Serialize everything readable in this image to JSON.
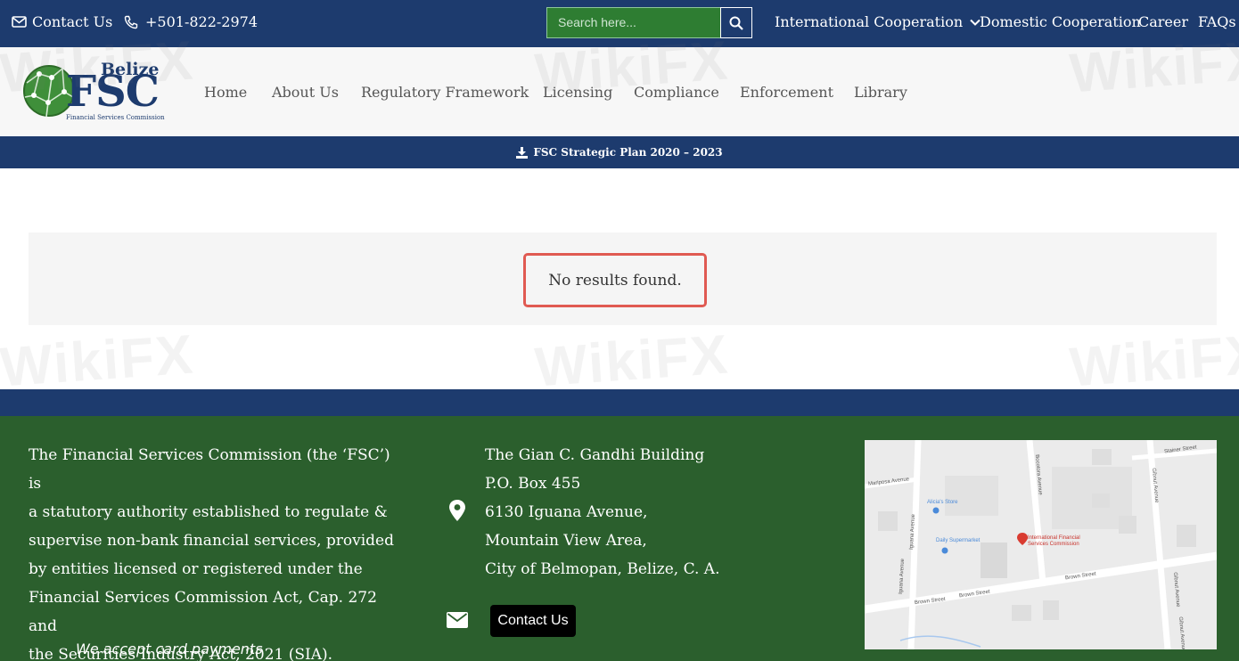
{
  "topbar": {
    "contact_label": "Contact Us",
    "phone": "+501-822-2974",
    "search_placeholder": "Search here...",
    "nav": [
      "International Cooperation",
      "Domestic Cooperation",
      "Career",
      "FAQs"
    ]
  },
  "logo": {
    "word_top": "Belize",
    "word_main": "FSC",
    "tagline": "Financial Services Commission"
  },
  "mainnav": [
    "Home",
    "About Us",
    "Regulatory Framework",
    "Licensing",
    "Compliance",
    "Enforcement",
    "Library"
  ],
  "banner": {
    "label": "FSC Strategic Plan 2020 – 2023"
  },
  "results": {
    "message": "No results found."
  },
  "footer": {
    "about_lines": [
      "The Financial Services Commission (the ‘FSC’) is",
      "a statutory authority established to regulate &",
      "supervise non-bank financial services, provided",
      "by entities licensed or registered under the",
      "Financial Services Commission Act, Cap. 272 and",
      "the Securities Industry Act, 2021 (SIA)."
    ],
    "cards_text": "We accept card payments",
    "address_lines": [
      "The Gian C. Gandhi Building",
      "P.O. Box 455",
      "6130 Iguana Avenue,",
      "Mountain View Area,",
      "City of Belmopan, Belize, C. A."
    ],
    "contact_button": "Contact Us"
  },
  "map": {
    "streets": [
      "Stainer Street",
      "Mariposa Avenue",
      "Bocotora Avenue",
      "Gibnut Avenue",
      "Iguana Avenue",
      "Brown Street",
      "Brown Street",
      "Brown Street",
      "Gibnut Avenue"
    ],
    "places": [
      "Alicia's Store",
      "Daily Supermarket"
    ],
    "marker_label_1": "International Financial",
    "marker_label_2": "Services Commission"
  },
  "watermark": "WikiFX",
  "colors": {
    "navy": "#1d3b6e",
    "green": "#2b5f2d",
    "highlight": "#e05a52"
  }
}
